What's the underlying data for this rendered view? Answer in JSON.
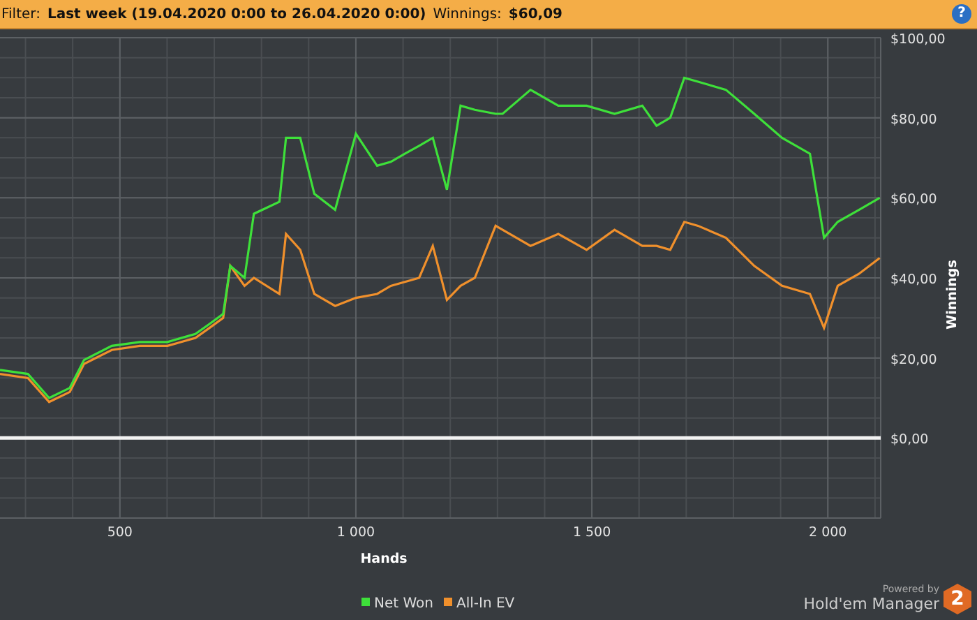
{
  "filter_bar": {
    "filter_label": "Filter:",
    "filter_value": "Last week (19.04.2020 0:00 to 26.04.2020 0:00)",
    "winnings_label": "Winnings:",
    "winnings_value": "$60,09",
    "help": "?"
  },
  "chart": {
    "chart_data": {
      "type": "line",
      "grid": true,
      "legend": true,
      "xlabel": "Hands",
      "ylabel": "Winnings",
      "xlim": [
        246,
        2112
      ],
      "ylim": [
        -20,
        100
      ],
      "xticks": [
        {
          "value": 500,
          "label": "500"
        },
        {
          "value": 1000,
          "label": "1 000"
        },
        {
          "value": 1500,
          "label": "1 500"
        },
        {
          "value": 2000,
          "label": "2 000"
        }
      ],
      "yticks": [
        {
          "value": 0,
          "label": "$0,00"
        },
        {
          "value": 20,
          "label": "$20,00"
        },
        {
          "value": 40,
          "label": "$40,00"
        },
        {
          "value": 60,
          "label": "$60,00"
        },
        {
          "value": 80,
          "label": "$80,00"
        },
        {
          "value": 100,
          "label": "$100,00"
        }
      ],
      "x": [
        246,
        305,
        350,
        394,
        424,
        483,
        542,
        601,
        660,
        690,
        719,
        734,
        764,
        784,
        838,
        852,
        882,
        912,
        956,
        1000,
        1045,
        1074,
        1104,
        1134,
        1163,
        1193,
        1222,
        1252,
        1296,
        1311,
        1370,
        1429,
        1489,
        1548,
        1607,
        1637,
        1666,
        1696,
        1725,
        1784,
        1844,
        1903,
        1962,
        1992,
        2021,
        2066,
        2110
      ],
      "series": [
        {
          "name": "Net Won",
          "color": "#3ee03a",
          "values": [
            17,
            16,
            10,
            12.5,
            19.5,
            23,
            24,
            24,
            26,
            28.5,
            31,
            43,
            40,
            56,
            59,
            75,
            75,
            61,
            57,
            76,
            68,
            69,
            71,
            73,
            75,
            62,
            83,
            82,
            81,
            81,
            87,
            83,
            83,
            81,
            83,
            78,
            80,
            90,
            89,
            87,
            81,
            75,
            71,
            50,
            54,
            57,
            60
          ]
        },
        {
          "name": "All-In EV",
          "color": "#f0902c",
          "values": [
            16,
            15,
            9,
            11.5,
            18.5,
            22,
            23,
            23,
            25,
            27.5,
            30,
            43,
            38,
            40,
            36,
            51,
            47,
            36,
            33,
            35,
            36,
            38,
            39,
            40,
            48,
            34.5,
            38,
            40,
            53,
            52,
            48,
            51,
            47,
            52,
            48,
            48,
            47,
            54,
            53,
            50,
            43,
            38,
            36,
            27.5,
            38,
            41,
            45
          ]
        }
      ]
    }
  },
  "branding": {
    "caption": "Powered by",
    "product": "Hold'em Manager",
    "badge": "2"
  }
}
